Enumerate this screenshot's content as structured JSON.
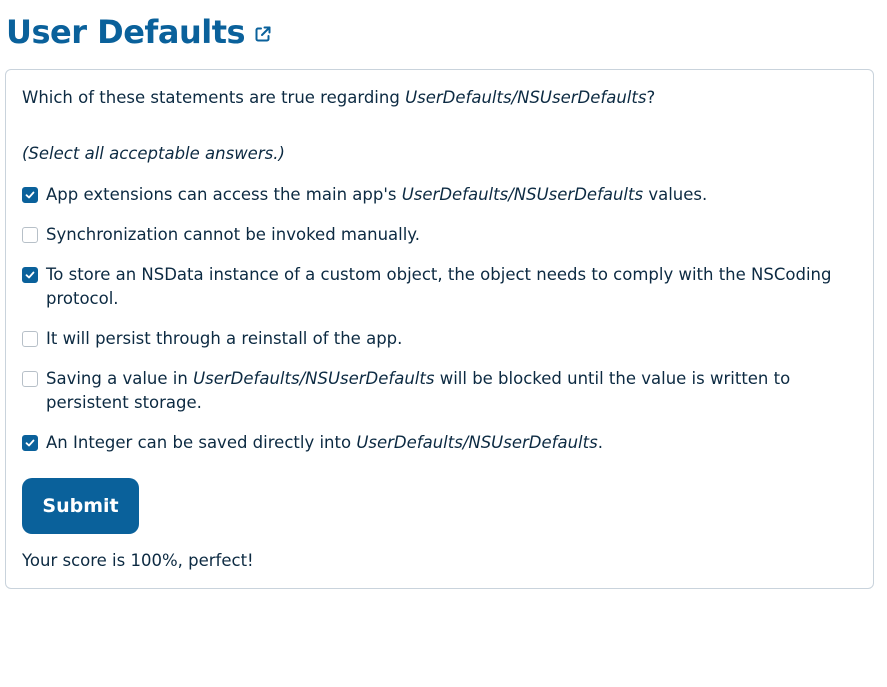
{
  "header": {
    "title": "User Defaults",
    "link_icon": "external-link-icon"
  },
  "quiz": {
    "question_prefix": "Which of these statements are true regarding ",
    "question_term": "UserDefaults/NSUserDefaults",
    "question_suffix": "?",
    "hint": "(Select all acceptable answers.)",
    "options": [
      {
        "checked": true,
        "pre": "App extensions can access the main app's ",
        "term": "UserDefaults/NSUserDefaults",
        "post": " values."
      },
      {
        "checked": false,
        "text": "Synchronization cannot be invoked manually."
      },
      {
        "checked": true,
        "text": "To store an NSData instance of a custom object, the object needs to comply with the NSCoding protocol."
      },
      {
        "checked": false,
        "text": "It will persist through a reinstall of the app."
      },
      {
        "checked": false,
        "pre": "Saving a value in ",
        "term": "UserDefaults/NSUserDefaults",
        "post": " will be blocked until the value is written to persistent storage."
      },
      {
        "checked": true,
        "pre": "An Integer can be saved directly into ",
        "term": "UserDefaults/NSUserDefaults",
        "post": "."
      }
    ],
    "submit_label": "Submit",
    "score_text": "Your score is 100%, perfect!"
  },
  "colors": {
    "accent": "#0a619b",
    "text": "#0c2a42",
    "border": "#c9d3dc"
  }
}
